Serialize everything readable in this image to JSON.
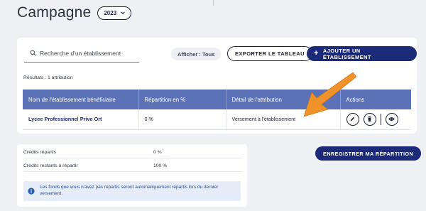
{
  "header": {
    "title": "Campagne",
    "year_select": {
      "value": "2023",
      "icon": "chevron-down-icon"
    }
  },
  "toolbar": {
    "search_placeholder": "Recherche d'un établissement",
    "search_icon": "search-icon",
    "filter_label": "Afficher : Tous",
    "export_label": "EXPORTER LE TABLEAU",
    "add_label": "AJOUTER UN ÉTABLISSEMENT",
    "add_icon": "plus-icon"
  },
  "results_text": "Résultats : 1 attribution",
  "table": {
    "headers": [
      "Nom de l'établissement bénéficiaire",
      "Répartition en %",
      "Détail de l'attribution",
      "Actions"
    ],
    "rows": [
      {
        "name": "Lycee Professionnel Prive Ort",
        "repartition": "0 %",
        "detail": "Versement à l'établissement",
        "actions": [
          "edit-icon",
          "trash-icon",
          "eye-icon"
        ]
      }
    ]
  },
  "credits": {
    "rows": [
      {
        "label": "Crédits répartis",
        "value": "0 %"
      },
      {
        "label": "Crédits restants à répartir",
        "value": "100 %"
      }
    ],
    "info_icon": "info-icon",
    "info_text": "Les fonds que vous n'avez pas répartis seront automatiquement répartis lors du dernier versement."
  },
  "save_label": "ENREGISTRER MA RÉPARTITION",
  "colors": {
    "primary": "#1c2a7a",
    "table_header": "#5b72b6",
    "annotation_arrow": "#f0922a",
    "info_bg": "#e6edf8"
  }
}
